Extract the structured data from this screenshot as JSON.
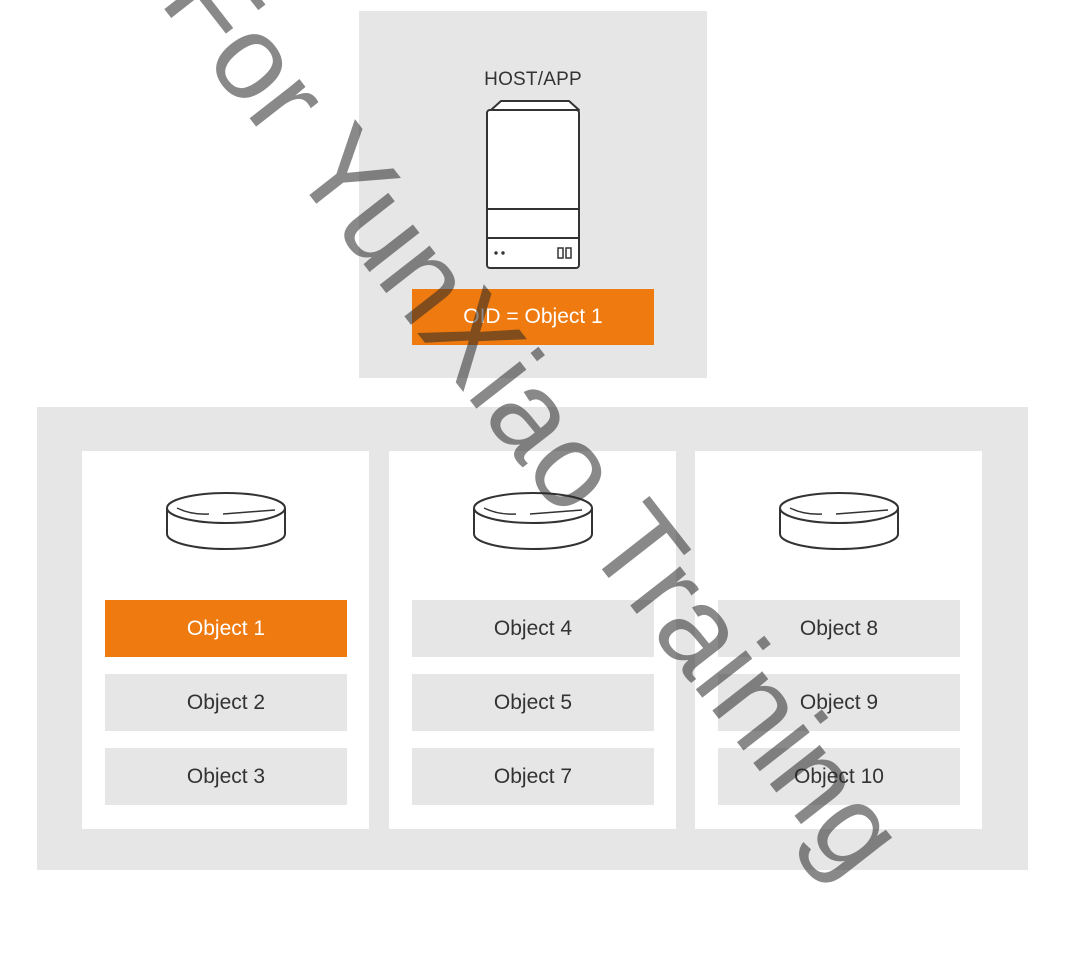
{
  "host": {
    "title": "HOST/APP",
    "oid_label": "OID = Object 1"
  },
  "columns": [
    {
      "objects": [
        "Object 1",
        "Object 2",
        "Object 3"
      ],
      "highlighted": "Object 1"
    },
    {
      "objects": [
        "Object 4",
        "Object 5",
        "Object 7"
      ]
    },
    {
      "objects": [
        "Object 8",
        "Object 9",
        "Object 10"
      ]
    }
  ],
  "watermark": "For YunXiao Training",
  "colors": {
    "accent": "#ee7a10",
    "panel": "#e6e6e6",
    "text": "#333333"
  }
}
